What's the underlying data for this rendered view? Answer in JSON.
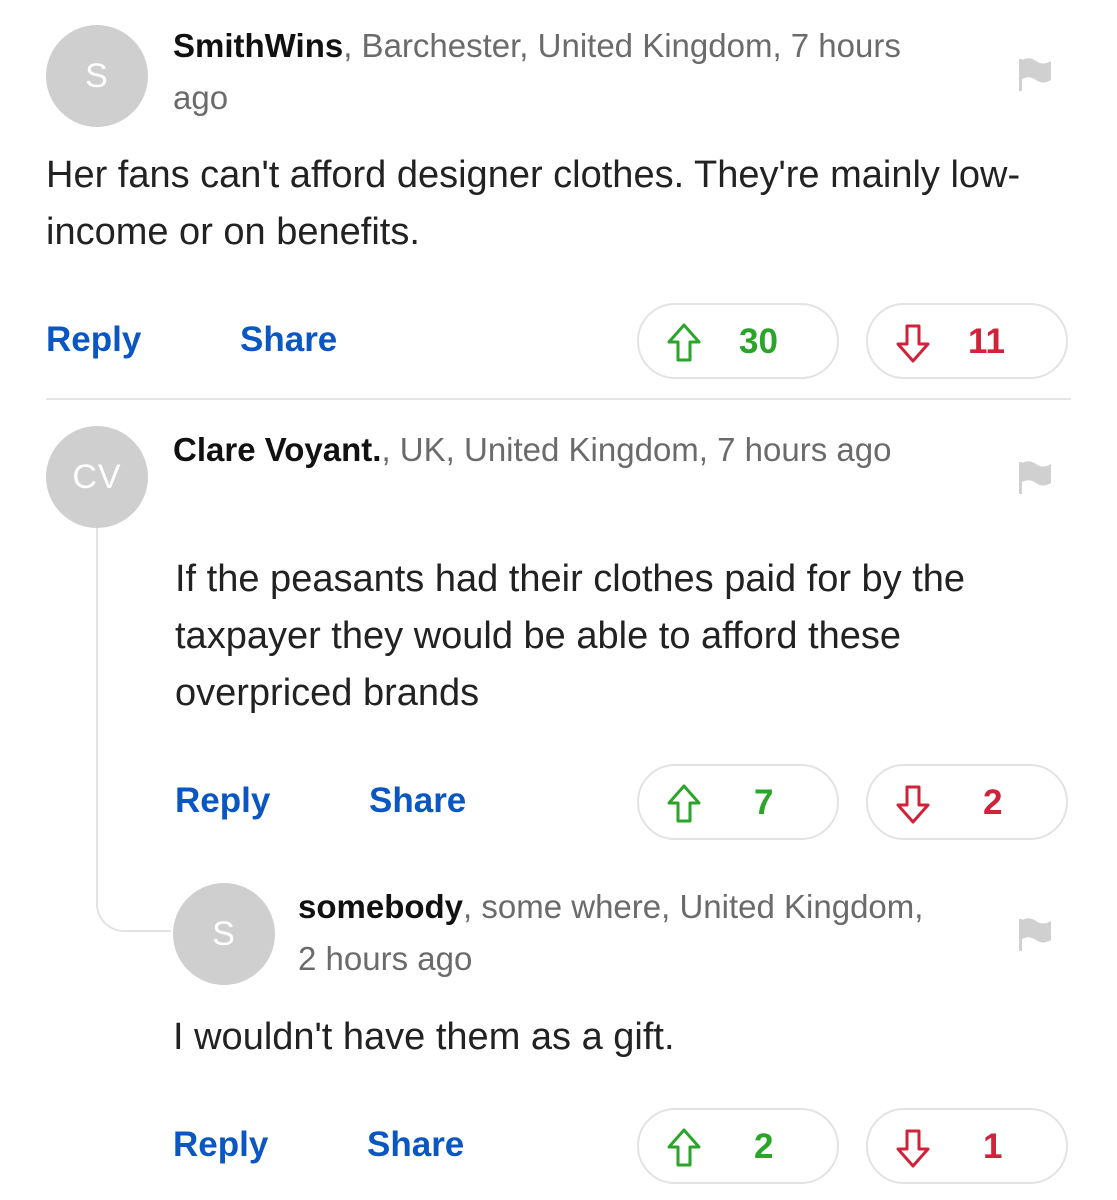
{
  "comments": [
    {
      "avatar": "S",
      "author": "SmithWins",
      "location_time": ", Barchester, United Kingdom, 7 hours ago",
      "text": "Her fans can't afford designer clothes. They're mainly low-income or on benefits.",
      "reply_label": "Reply",
      "share_label": "Share",
      "upvotes": "30",
      "downvotes": "11"
    },
    {
      "avatar": "CV",
      "author": "Clare Voyant.",
      "location_time": ", UK, United Kingdom, 7 hours ago",
      "text": "If the peasants had their clothes paid for by the taxpayer they would be able to afford these overpriced brands",
      "reply_label": "Reply",
      "share_label": "Share",
      "upvotes": "7",
      "downvotes": "2"
    },
    {
      "avatar": "S",
      "author": "somebody",
      "location_time": ", some where, United Kingdom, 2 hours ago",
      "text": "I wouldn't have them as a gift.",
      "reply_label": "Reply",
      "share_label": "Share",
      "upvotes": "2",
      "downvotes": "1"
    }
  ],
  "icons": {
    "flag": "flag-icon",
    "upvote": "arrow-up-icon",
    "downvote": "arrow-down-icon"
  },
  "colors": {
    "link": "#0a56c2",
    "upvote": "#2aa52a",
    "downvote": "#d0223a",
    "avatar_bg": "#cfcfcf"
  }
}
